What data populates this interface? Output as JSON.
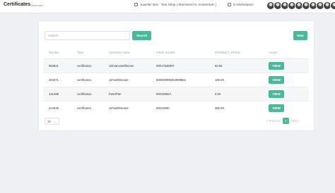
{
  "header": {
    "title": "Certificates",
    "breadcrumb": "Dashboard",
    "shop": "Juweller Box - Test Shop ( Mainstreet 8, Amsterdam )",
    "workstation": "N Workstation",
    "avatar_count": 10
  },
  "toolbar": {
    "search_placeholder": "Search",
    "search_label": "Search",
    "new_label": "New"
  },
  "table": {
    "columns": [
      "Number",
      "Type",
      "Customer name",
      "Article number",
      "PRODUCT_PRICE",
      "Action"
    ],
    "rows": [
      {
        "number": "953521",
        "type": "certificate1",
        "customer": "JolmanvanElkenen",
        "article": "00017536907",
        "price": "50.00",
        "action": "VIEW"
      },
      {
        "number": "403371",
        "type": "certificate1",
        "customer": "JohnelElsean2",
        "article": "000000995252999864",
        "price": "100.00",
        "action": "VIEW"
      },
      {
        "number": "141499",
        "type": "certificate1",
        "customer": "PeterPan",
        "article": "00015062A",
        "price": "0.00",
        "action": "VIEW"
      },
      {
        "number": "212526",
        "type": "certificate1",
        "customer": "JohnelElsean2",
        "article": "00015080",
        "price": "300.00",
        "action": "VIEW"
      }
    ]
  },
  "footer": {
    "page_size": "10",
    "previous": "< Previous",
    "current_page": "1",
    "next": "Next >"
  },
  "colors": {
    "accent": "#4cb89a",
    "background": "#eef0f4"
  }
}
